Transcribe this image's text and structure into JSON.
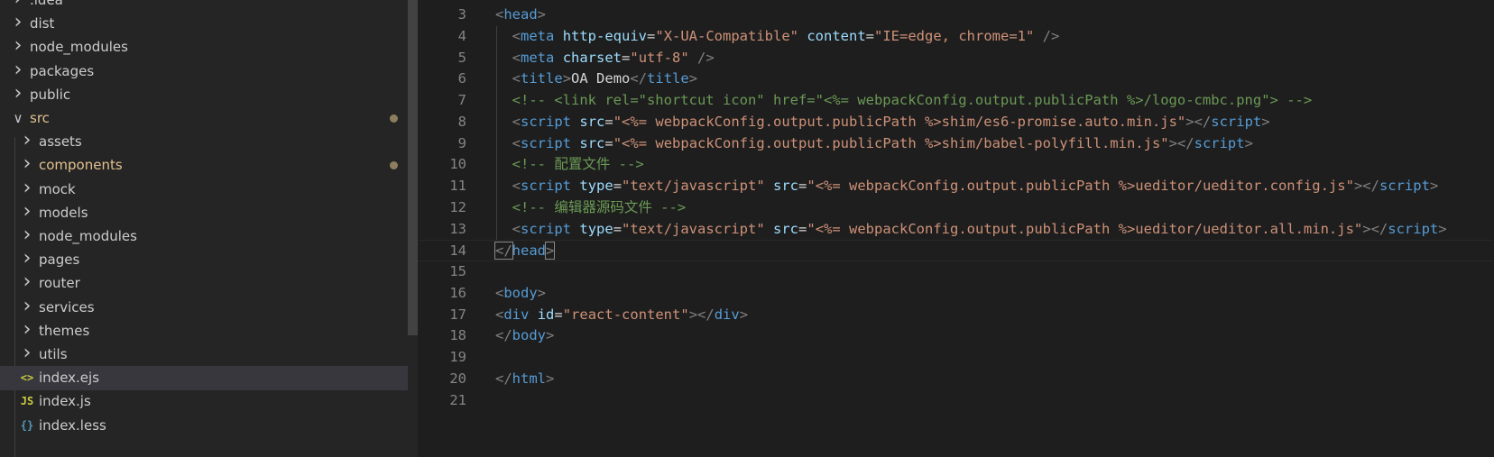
{
  "explorer": {
    "items": [
      {
        "label": ".idea",
        "kind": "folder",
        "state": "collapsed",
        "depth": 0
      },
      {
        "label": "dist",
        "kind": "folder",
        "state": "collapsed",
        "depth": 0
      },
      {
        "label": "node_modules",
        "kind": "folder",
        "state": "collapsed",
        "depth": 0
      },
      {
        "label": "packages",
        "kind": "folder",
        "state": "collapsed",
        "depth": 0
      },
      {
        "label": "public",
        "kind": "folder",
        "state": "collapsed",
        "depth": 0
      },
      {
        "label": "src",
        "kind": "folder",
        "state": "expanded",
        "depth": 0,
        "modified": true
      },
      {
        "label": "assets",
        "kind": "folder",
        "state": "collapsed",
        "depth": 1
      },
      {
        "label": "components",
        "kind": "folder",
        "state": "collapsed",
        "depth": 1,
        "modified": true
      },
      {
        "label": "mock",
        "kind": "folder",
        "state": "collapsed",
        "depth": 1
      },
      {
        "label": "models",
        "kind": "folder",
        "state": "collapsed",
        "depth": 1
      },
      {
        "label": "node_modules",
        "kind": "folder",
        "state": "collapsed",
        "depth": 1
      },
      {
        "label": "pages",
        "kind": "folder",
        "state": "collapsed",
        "depth": 1
      },
      {
        "label": "router",
        "kind": "folder",
        "state": "collapsed",
        "depth": 1
      },
      {
        "label": "services",
        "kind": "folder",
        "state": "collapsed",
        "depth": 1
      },
      {
        "label": "themes",
        "kind": "folder",
        "state": "collapsed",
        "depth": 1
      },
      {
        "label": "utils",
        "kind": "folder",
        "state": "collapsed",
        "depth": 1
      },
      {
        "label": "index.ejs",
        "kind": "file",
        "icon": "<>",
        "iconName": "ejs-file-icon",
        "iconColor": "#cbcb41",
        "depth": 1,
        "selected": true
      },
      {
        "label": "index.js",
        "kind": "file",
        "icon": "JS",
        "iconName": "js-file-icon",
        "iconColor": "#cbcb41",
        "depth": 1
      },
      {
        "label": "index.less",
        "kind": "file",
        "icon": "{}",
        "iconName": "less-file-icon",
        "iconColor": "#519aba",
        "depth": 1
      }
    ]
  },
  "editor": {
    "cursor_line": "14",
    "lines": [
      {
        "n": "3",
        "indent": 0,
        "tokens": [
          [
            "t-punc",
            "<"
          ],
          [
            "t-tag",
            "head"
          ],
          [
            "t-punc",
            ">"
          ]
        ]
      },
      {
        "n": "4",
        "indent": 1,
        "tokens": [
          [
            "t-punc",
            "<"
          ],
          [
            "t-tag",
            "meta"
          ],
          [
            "t-text",
            " "
          ],
          [
            "t-attr",
            "http-equiv"
          ],
          [
            "t-text",
            "="
          ],
          [
            "t-str",
            "\"X-UA-Compatible\""
          ],
          [
            "t-text",
            " "
          ],
          [
            "t-attr",
            "content"
          ],
          [
            "t-text",
            "="
          ],
          [
            "t-str",
            "\"IE=edge, chrome=1\""
          ],
          [
            "t-text",
            " "
          ],
          [
            "t-punc",
            "/>"
          ]
        ]
      },
      {
        "n": "5",
        "indent": 1,
        "tokens": [
          [
            "t-punc",
            "<"
          ],
          [
            "t-tag",
            "meta"
          ],
          [
            "t-text",
            " "
          ],
          [
            "t-attr",
            "charset"
          ],
          [
            "t-text",
            "="
          ],
          [
            "t-str",
            "\"utf-8\""
          ],
          [
            "t-text",
            " "
          ],
          [
            "t-punc",
            "/>"
          ]
        ]
      },
      {
        "n": "6",
        "indent": 1,
        "tokens": [
          [
            "t-punc",
            "<"
          ],
          [
            "t-tag",
            "title"
          ],
          [
            "t-punc",
            ">"
          ],
          [
            "t-text",
            "OA Demo"
          ],
          [
            "t-punc",
            "</"
          ],
          [
            "t-tag",
            "title"
          ],
          [
            "t-punc",
            ">"
          ]
        ]
      },
      {
        "n": "7",
        "indent": 1,
        "tokens": [
          [
            "t-comment",
            "<!-- <link rel=\"shortcut icon\" href=\"<%= webpackConfig.output.publicPath %>/logo-cmbc.png\"> -->"
          ]
        ]
      },
      {
        "n": "8",
        "indent": 1,
        "tokens": [
          [
            "t-punc",
            "<"
          ],
          [
            "t-tag",
            "script"
          ],
          [
            "t-text",
            " "
          ],
          [
            "t-attr",
            "src"
          ],
          [
            "t-text",
            "="
          ],
          [
            "t-str",
            "\"<%= webpackConfig.output.publicPath %>shim/es6-promise.auto.min.js\""
          ],
          [
            "t-punc",
            "></"
          ],
          [
            "t-tag",
            "script"
          ],
          [
            "t-punc",
            ">"
          ]
        ]
      },
      {
        "n": "9",
        "indent": 1,
        "tokens": [
          [
            "t-punc",
            "<"
          ],
          [
            "t-tag",
            "script"
          ],
          [
            "t-text",
            " "
          ],
          [
            "t-attr",
            "src"
          ],
          [
            "t-text",
            "="
          ],
          [
            "t-str",
            "\"<%= webpackConfig.output.publicPath %>shim/babel-polyfill.min.js\""
          ],
          [
            "t-punc",
            "></"
          ],
          [
            "t-tag",
            "script"
          ],
          [
            "t-punc",
            ">"
          ]
        ]
      },
      {
        "n": "10",
        "indent": 1,
        "tokens": [
          [
            "t-comment",
            "<!-- 配置文件 -->"
          ]
        ]
      },
      {
        "n": "11",
        "indent": 1,
        "tokens": [
          [
            "t-punc",
            "<"
          ],
          [
            "t-tag",
            "script"
          ],
          [
            "t-text",
            " "
          ],
          [
            "t-attr",
            "type"
          ],
          [
            "t-text",
            "="
          ],
          [
            "t-str",
            "\"text/javascript\""
          ],
          [
            "t-text",
            " "
          ],
          [
            "t-attr",
            "src"
          ],
          [
            "t-text",
            "="
          ],
          [
            "t-str",
            "\"<%= webpackConfig.output.publicPath %>ueditor/ueditor.config.js\""
          ],
          [
            "t-punc",
            "></"
          ],
          [
            "t-tag",
            "script"
          ],
          [
            "t-punc",
            ">"
          ]
        ]
      },
      {
        "n": "12",
        "indent": 1,
        "tokens": [
          [
            "t-comment",
            "<!-- 编辑器源码文件 -->"
          ]
        ]
      },
      {
        "n": "13",
        "indent": 1,
        "tokens": [
          [
            "t-punc",
            "<"
          ],
          [
            "t-tag",
            "script"
          ],
          [
            "t-text",
            " "
          ],
          [
            "t-attr",
            "type"
          ],
          [
            "t-text",
            "="
          ],
          [
            "t-str",
            "\"text/javascript\""
          ],
          [
            "t-text",
            " "
          ],
          [
            "t-attr",
            "src"
          ],
          [
            "t-text",
            "="
          ],
          [
            "t-str",
            "\"<%= webpackConfig.output.publicPath %>ueditor/ueditor.all.min.js\""
          ],
          [
            "t-punc",
            "></"
          ],
          [
            "t-tag",
            "script"
          ],
          [
            "t-punc",
            ">"
          ]
        ]
      },
      {
        "n": "14",
        "indent": 0,
        "tokens": [
          [
            "t-punc",
            "</"
          ],
          [
            "t-tag",
            "head"
          ],
          [
            "t-punc",
            ">"
          ]
        ]
      },
      {
        "n": "15",
        "indent": 0,
        "tokens": []
      },
      {
        "n": "16",
        "indent": 0,
        "tokens": [
          [
            "t-punc",
            "<"
          ],
          [
            "t-tag",
            "body"
          ],
          [
            "t-punc",
            ">"
          ]
        ]
      },
      {
        "n": "17",
        "indent": 0,
        "tokens": [
          [
            "t-punc",
            "<"
          ],
          [
            "t-tag",
            "div"
          ],
          [
            "t-text",
            " "
          ],
          [
            "t-attr",
            "id"
          ],
          [
            "t-text",
            "="
          ],
          [
            "t-str",
            "\"react-content\""
          ],
          [
            "t-punc",
            "></"
          ],
          [
            "t-tag",
            "div"
          ],
          [
            "t-punc",
            ">"
          ]
        ]
      },
      {
        "n": "18",
        "indent": 0,
        "tokens": [
          [
            "t-punc",
            "</"
          ],
          [
            "t-tag",
            "body"
          ],
          [
            "t-punc",
            ">"
          ]
        ]
      },
      {
        "n": "19",
        "indent": 0,
        "tokens": []
      },
      {
        "n": "20",
        "indent": 0,
        "tokens": [
          [
            "t-punc",
            "</"
          ],
          [
            "t-tag",
            "html"
          ],
          [
            "t-punc",
            ">"
          ]
        ]
      },
      {
        "n": "21",
        "indent": 0,
        "tokens": []
      }
    ]
  }
}
